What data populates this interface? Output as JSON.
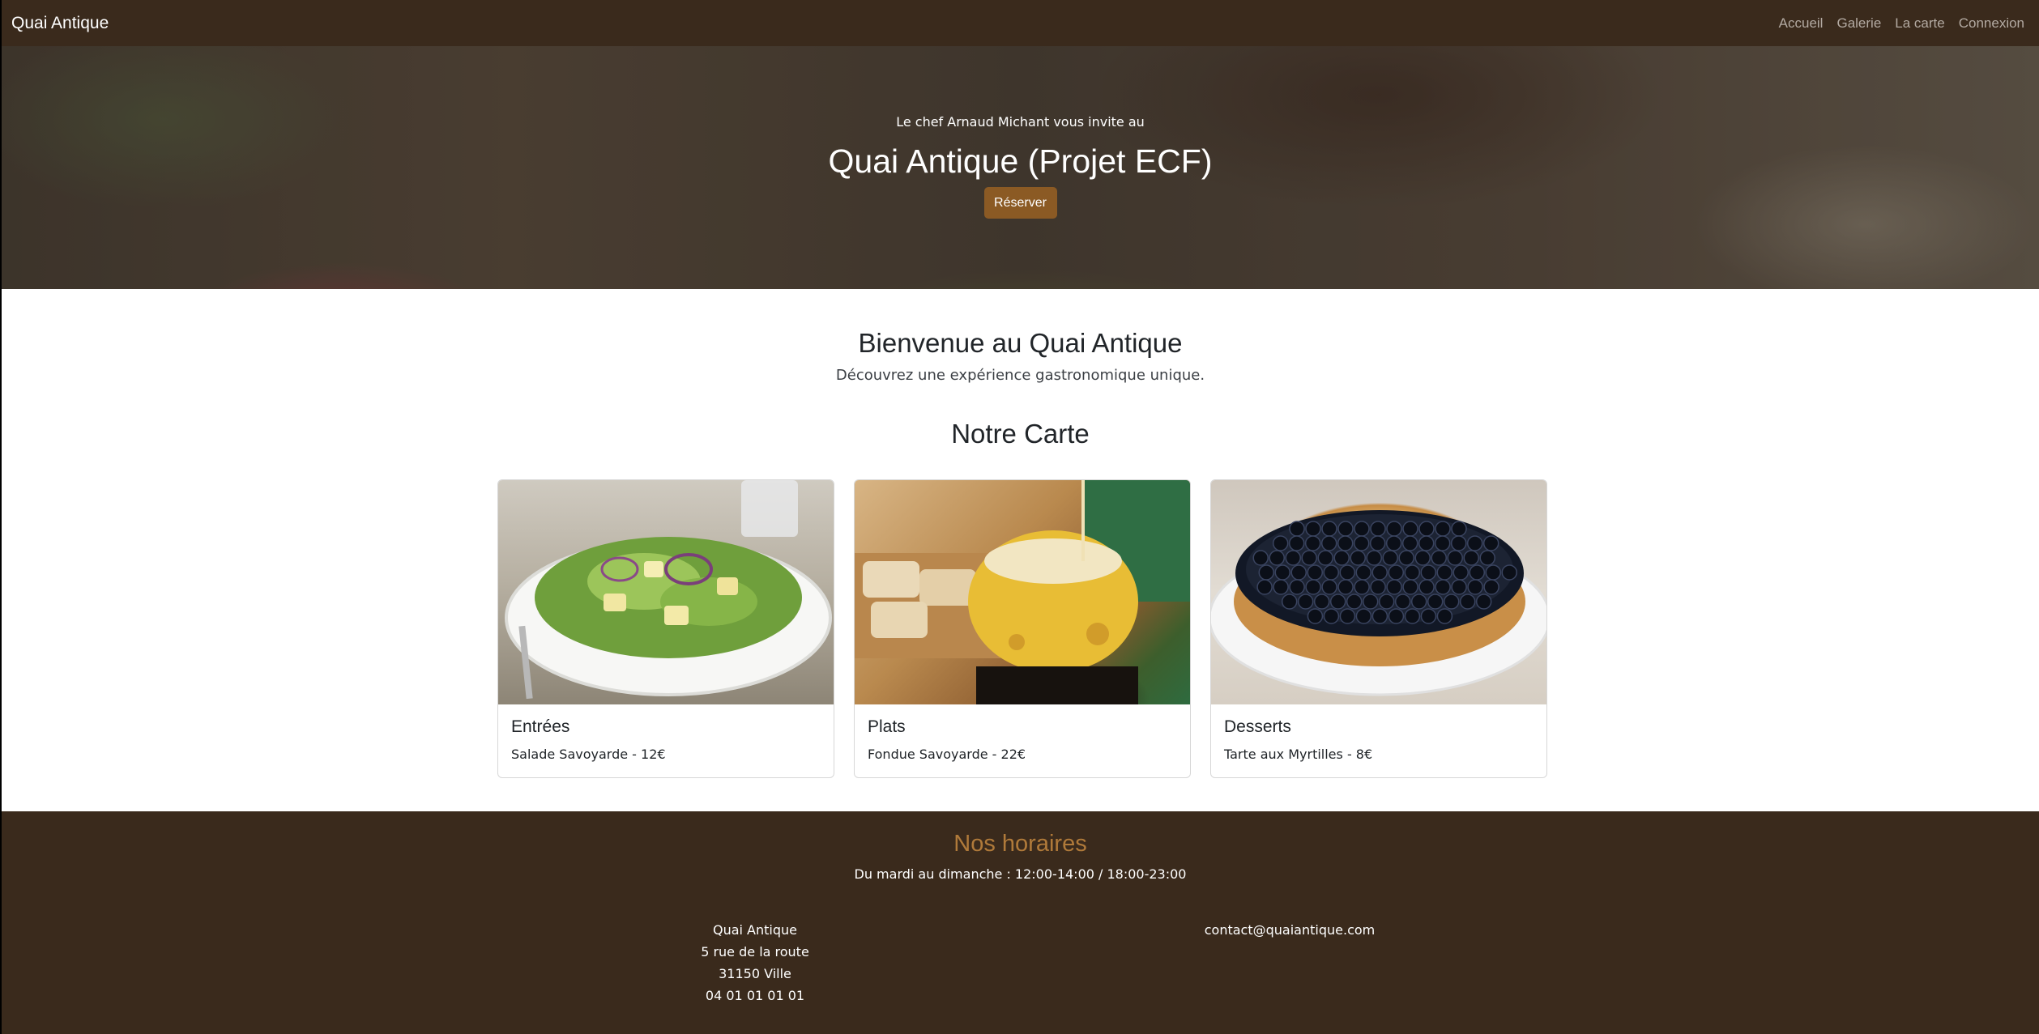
{
  "navbar": {
    "brand": "Quai Antique",
    "links": [
      "Accueil",
      "Galerie",
      "La carte",
      "Connexion"
    ]
  },
  "hero": {
    "kicker": "Le chef Arnaud Michant vous invite au",
    "title": "Quai Antique (Projet ECF)",
    "button_label": "Réserver"
  },
  "welcome": {
    "title": "Bienvenue au Quai Antique",
    "subtitle": "Découvrez une expérience gastronomique unique."
  },
  "carte": {
    "title": "Notre Carte",
    "cards": [
      {
        "title": "Entrées",
        "item": "Salade Savoyarde - 12€",
        "image": "salad-photo"
      },
      {
        "title": "Plats",
        "item": "Fondue Savoyarde - 22€",
        "image": "fondue-photo"
      },
      {
        "title": "Desserts",
        "item": "Tarte aux Myrtilles - 8€",
        "image": "blueberry-tart-photo"
      }
    ]
  },
  "footer": {
    "title": "Nos horaires",
    "hours": "Du mardi au dimanche : 12:00-14:00 / 18:00-23:00",
    "address": [
      "Quai Antique",
      "5 rue de la route",
      "31150 Ville",
      "04 01 01 01 01"
    ],
    "email": "contact@quaiantique.com"
  },
  "colors": {
    "nav_bg": "#3a2a1c",
    "accent": "#8b5a24",
    "footer_title": "#b07a3a"
  }
}
